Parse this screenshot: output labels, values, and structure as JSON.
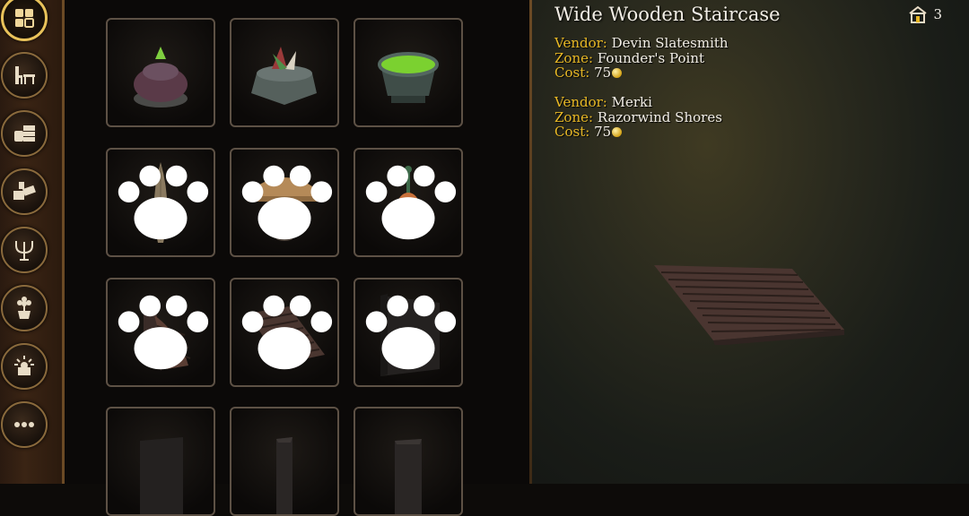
{
  "categories": [
    {
      "icon": "grid-icon",
      "active": true
    },
    {
      "icon": "furniture-icon",
      "active": false
    },
    {
      "icon": "storage-icon",
      "active": false
    },
    {
      "icon": "structure-icon",
      "active": false
    },
    {
      "icon": "candelabra-icon",
      "active": false
    },
    {
      "icon": "plant-icon",
      "active": false
    },
    {
      "icon": "lighting-icon",
      "active": false
    },
    {
      "icon": "more-icon",
      "active": false
    }
  ],
  "items": [
    {
      "icon": "stone-orb-pedestal-icon",
      "bound": false
    },
    {
      "icon": "crystal-stone-planter-icon",
      "bound": false
    },
    {
      "icon": "green-cauldron-icon",
      "bound": false
    },
    {
      "icon": "surfboard-icon",
      "bound": true
    },
    {
      "icon": "thatched-umbrella-icon",
      "bound": true
    },
    {
      "icon": "hanging-lantern-icon",
      "bound": true
    },
    {
      "icon": "spiral-staircase-icon",
      "bound": true
    },
    {
      "icon": "wide-wooden-staircase-icon",
      "bound": true
    },
    {
      "icon": "dark-wall-panel-icon",
      "bound": true
    },
    {
      "icon": "dark-block-icon",
      "bound": false
    },
    {
      "icon": "dark-pillar-icon",
      "bound": false
    },
    {
      "icon": "dark-pillar-tall-icon",
      "bound": false
    }
  ],
  "detail": {
    "title": "Wide Wooden Staircase",
    "owned_count": "3",
    "vendors": [
      {
        "vendor_label": "Vendor:",
        "vendor": "Devin Slatesmith",
        "zone_label": "Zone:",
        "zone": "Founder's Point",
        "cost_label": "Cost:",
        "cost": "75"
      },
      {
        "vendor_label": "Vendor:",
        "vendor": "Merki",
        "zone_label": "Zone:",
        "zone": "Razorwind Shores",
        "cost_label": "Cost:",
        "cost": "75"
      }
    ]
  },
  "colors": {
    "label_gold": "#e8b825",
    "text_white": "#f2eee6",
    "frame_gold": "#e8c25a"
  }
}
